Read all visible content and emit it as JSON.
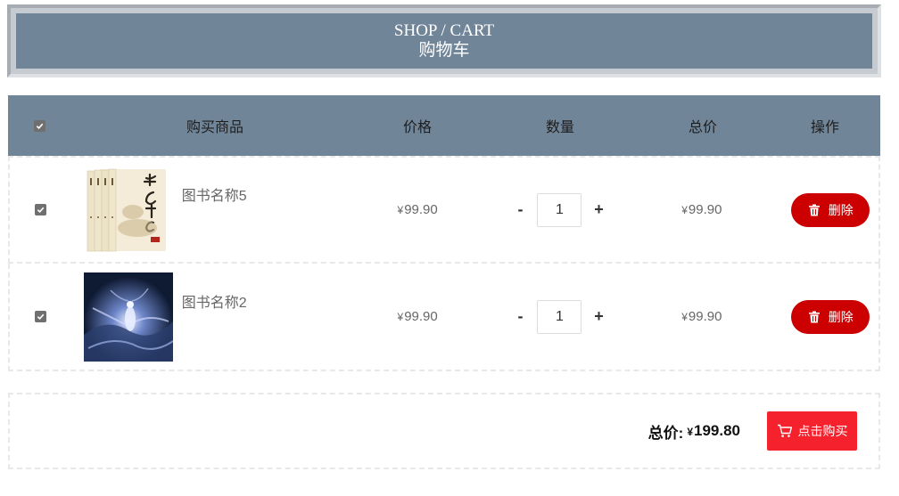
{
  "header": {
    "title": "SHOP / CART",
    "subtitle": "购物车"
  },
  "table": {
    "columns": {
      "product": "购买商品",
      "price": "价格",
      "quantity": "数量",
      "total": "总价",
      "operation": "操作"
    },
    "select_all_checked": true,
    "rows": [
      {
        "checked": true,
        "name": "图书名称5",
        "currency": "¥",
        "price": "99.90",
        "quantity": "1",
        "total": "99.90",
        "delete_label": "删除",
        "thumb_icon": "book-box-set-image"
      },
      {
        "checked": true,
        "name": "图书名称2",
        "currency": "¥",
        "price": "99.90",
        "quantity": "1",
        "total": "99.90",
        "delete_label": "删除",
        "thumb_icon": "fantasy-art-image"
      }
    ],
    "decrement_label": "-",
    "increment_label": "+"
  },
  "footer": {
    "sum_label": "总价:",
    "currency": "¥",
    "sum_value": "199.80",
    "buy_label": "点击购买"
  },
  "colors": {
    "header_bg": "#718599",
    "delete_button": "#cc0000",
    "buy_button": "#f5222d"
  }
}
